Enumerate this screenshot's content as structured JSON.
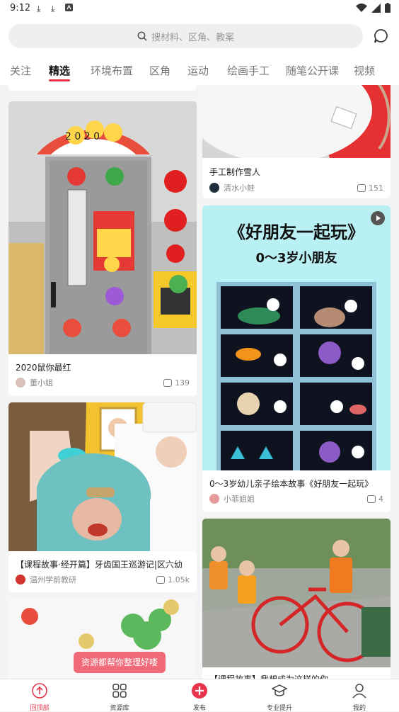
{
  "status_bar": {
    "time": "9:12"
  },
  "search": {
    "placeholder": "搜材料、区角、教案"
  },
  "tabs": [
    "关注",
    "精选",
    "环境布置",
    "区角",
    "运动",
    "绘画手工",
    "随笔公开课",
    "视频"
  ],
  "active_tab": "精选",
  "feed": {
    "left": [
      {
        "title": "2020鼠你最红",
        "author": "董小姐",
        "comments": "139"
      },
      {
        "title": "【课程故事·经开篇】牙齿国王巡游记|区六幼",
        "author": "温州学前教研",
        "comments": "1.05k"
      }
    ],
    "right": [
      {
        "title": "手工制作雪人",
        "author": "清水小鲑",
        "comments": "151"
      },
      {
        "title": "0～3岁幼儿亲子绘本故事《好朋友一起玩》",
        "author": "小菲姐姐",
        "comments": "4",
        "poster_title": "《好朋友一起玩》",
        "poster_subtitle": "0～3岁小朋友"
      },
      {
        "title": "【课程故事】我想成为这样的你"
      }
    ]
  },
  "toast": "资源都帮你整理好喽",
  "bottom_nav": [
    {
      "label": "回顶部",
      "icon": "up-arrow-icon"
    },
    {
      "label": "资源库",
      "icon": "grid-icon"
    },
    {
      "label": "发布",
      "icon": "plus-icon"
    },
    {
      "label": "专业提升",
      "icon": "graduation-cap-icon"
    },
    {
      "label": "我的",
      "icon": "person-icon"
    }
  ],
  "colors": {
    "accent": "#e8344c",
    "toast": "#f06a7a",
    "poster_bg": "#b9f0f4"
  }
}
